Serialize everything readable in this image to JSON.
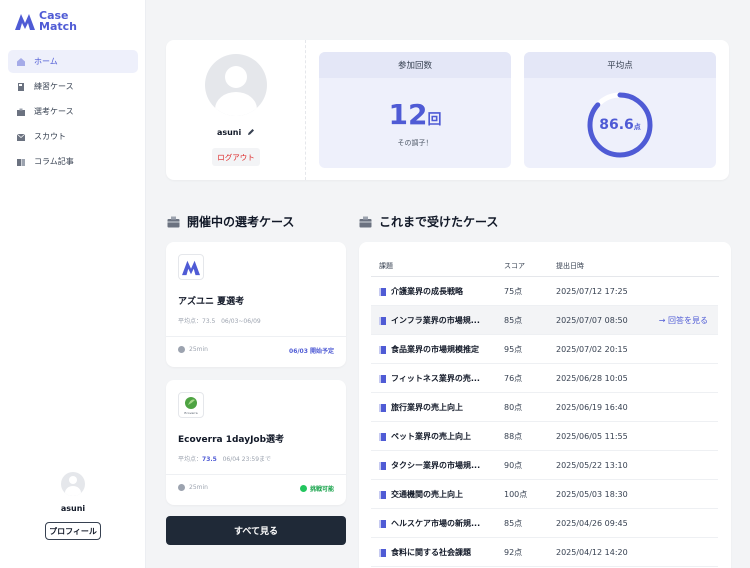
{
  "brand": {
    "line1": "Case",
    "line2": "Match",
    "color": "#4f5bd5"
  },
  "sidebar": {
    "items": [
      {
        "label": "ホーム",
        "icon": "home-icon",
        "active": true
      },
      {
        "label": "練習ケース",
        "icon": "notebook-icon",
        "active": false
      },
      {
        "label": "選考ケース",
        "icon": "briefcase-icon",
        "active": false
      },
      {
        "label": "スカウト",
        "icon": "mail-icon",
        "active": false
      },
      {
        "label": "コラム記事",
        "icon": "book-icon",
        "active": false
      }
    ],
    "user_name": "asuni",
    "profile_button": "プロフィール"
  },
  "profile": {
    "name": "asuni",
    "logout": "ログアウト"
  },
  "stats": {
    "count": {
      "label": "参加回数",
      "value": "12",
      "unit": "回",
      "sub": "その調子！"
    },
    "average": {
      "label": "平均点",
      "value": "86.6",
      "unit": "点",
      "percent": 86.6
    }
  },
  "open_cases": {
    "title": "開催中の選考ケース",
    "cards": [
      {
        "title": "アズユニ 夏選考",
        "avg_label": "平均点：73.5",
        "period": "06/03~06/09",
        "duration": "25min",
        "status": "06/03 開始予定"
      },
      {
        "title": "Ecoverra 1dayJob選考",
        "avg_label": "平均点：",
        "avg_value": "73.5",
        "period": "06/04 23:59まで",
        "duration": "25min",
        "status": "挑戦可能",
        "logo_text": "Ecoverra"
      }
    ],
    "all_button": "すべて見る"
  },
  "history": {
    "title": "これまで受けたケース",
    "columns": [
      "課題",
      "スコア",
      "提出日時"
    ],
    "hover_link": "→ 回答を見る",
    "rows": [
      {
        "title": "介護業界の成長戦略",
        "score": "75点",
        "date": "2025/07/12 17:25"
      },
      {
        "title": "インフラ業界の市場規...",
        "score": "85点",
        "date": "2025/07/07 08:50"
      },
      {
        "title": "食品業界の市場規模推定",
        "score": "95点",
        "date": "2025/07/02 20:15"
      },
      {
        "title": "フィットネス業界の売...",
        "score": "76点",
        "date": "2025/06/28 10:05"
      },
      {
        "title": "旅行業界の売上向上",
        "score": "80点",
        "date": "2025/06/19 16:40"
      },
      {
        "title": "ペット業界の売上向上",
        "score": "88点",
        "date": "2025/06/05 11:55"
      },
      {
        "title": "タクシー業界の市場規...",
        "score": "90点",
        "date": "2025/05/22 13:10"
      },
      {
        "title": "交通機関の売上向上",
        "score": "100点",
        "date": "2025/05/03 18:30"
      },
      {
        "title": "ヘルスケア市場の新規...",
        "score": "85点",
        "date": "2025/04/26 09:45"
      },
      {
        "title": "食料に関する社会課題",
        "score": "92点",
        "date": "2025/04/12 14:20"
      }
    ]
  }
}
